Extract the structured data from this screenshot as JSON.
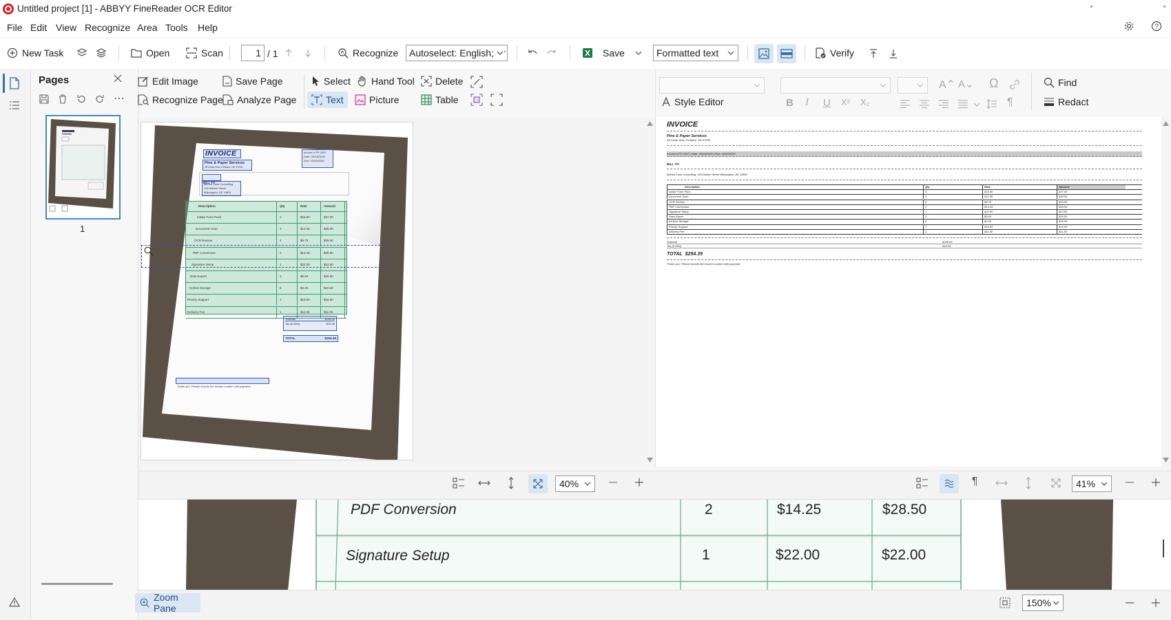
{
  "window": {
    "title": "Untitled project [1] - ABBYY FineReader OCR Editor"
  },
  "menu": [
    "File",
    "Edit",
    "View",
    "Recognize",
    "Area",
    "Tools",
    "Help"
  ],
  "toolbar": {
    "new_task": "New Task",
    "open": "Open",
    "scan": "Scan",
    "page_current": "1",
    "page_total": "/ 1",
    "recognize": "Recognize",
    "language": "Autoselect: English; Fr",
    "save": "Save",
    "format": "Formatted text",
    "verify": "Verify"
  },
  "pages_pane": {
    "title": "Pages",
    "thumb_label": "1"
  },
  "image_toolbar": {
    "edit_image": "Edit Image",
    "save_page": "Save Page",
    "select": "Select",
    "hand_tool": "Hand Tool",
    "delete": "Delete",
    "recognize_page": "Recognize Page",
    "analyze_page": "Analyze Page",
    "text": "Text",
    "picture": "Picture",
    "table": "Table"
  },
  "text_toolbar": {
    "style_editor": "Style Editor",
    "find": "Find",
    "redact": "Redact"
  },
  "image_zoom": "40%",
  "text_zoom": "41%",
  "zoom_pane": {
    "button": "Zoom Pane",
    "zoom": "150%"
  },
  "document": {
    "title": "INVOICE",
    "company": "Pine & Paper Services",
    "address": "48 Cedar Row, Portland, OR 97205",
    "invoice_no": "Invoice # PP-2047",
    "date": "Date: 09/18/2026",
    "due": "Due: 10/03/2026",
    "bill_to": "BILL TO",
    "client": "Merlon Lane Consulting",
    "client_street": "126 Market Street",
    "client_city": "Wilmington, DE 19801",
    "columns": [
      "Description",
      "Qty",
      "Rate",
      "Amount"
    ],
    "items": [
      {
        "desc": "Intake Form Pack",
        "qty": "2",
        "rate": "$18.50",
        "amount": "$37.00"
      },
      {
        "desc": "Document Scan",
        "qty": "3",
        "rate": "$12.00",
        "amount": "$36.00"
      },
      {
        "desc": "OCR Review",
        "qty": "4",
        "rate": "$9.75",
        "amount": "$39.00"
      },
      {
        "desc": "PDF Conversion",
        "qty": "2",
        "rate": "$14.25",
        "amount": "$28.50"
      },
      {
        "desc": "Signature Setup",
        "qty": "1",
        "rate": "$22.00",
        "amount": "$22.00"
      },
      {
        "desc": "Data Export",
        "qty": "3",
        "rate": "$8.50",
        "amount": "$25.50"
      },
      {
        "desc": "Archive Storage",
        "qty": "6",
        "rate": "$3.25",
        "amount": "$19.50"
      },
      {
        "desc": "Priority Support",
        "qty": "1",
        "rate": "$16.00",
        "amount": "$16.00"
      },
      {
        "desc": "Delivery Fee",
        "qty": "1",
        "rate": "$11.50",
        "amount": "$11.50"
      }
    ],
    "subtotal_label": "Subtotal",
    "subtotal": "$235.00",
    "tax_label": "Tax (8.25%)",
    "tax": "$19.39",
    "total_label": "TOTAL",
    "total": "$254.39",
    "footer": "Thank you. Please include the invoice number with payment.",
    "text_header_line": "Invoice # PP-2047 | Date: 09/18/2026 | Due: 10/03/2026",
    "text_client_line": "Merlon Lane Consulting, 126 Market Street Wilmington, DE 19801"
  }
}
